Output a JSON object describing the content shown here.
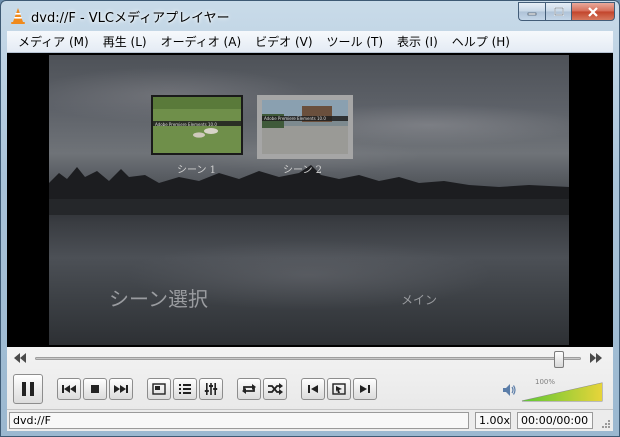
{
  "window": {
    "title": "dvd://F - VLCメディアプレイヤー"
  },
  "menu": {
    "items": [
      {
        "id": "media",
        "label": "メディア (M)"
      },
      {
        "id": "playback",
        "label": "再生 (L)"
      },
      {
        "id": "audio",
        "label": "オーディオ (A)"
      },
      {
        "id": "video",
        "label": "ビデオ (V)"
      },
      {
        "id": "tools",
        "label": "ツール (T)"
      },
      {
        "id": "view",
        "label": "表示 (I)"
      },
      {
        "id": "help",
        "label": "ヘルプ (H)"
      }
    ]
  },
  "dvd_menu": {
    "title": "シーン選択",
    "main_link": "メイン",
    "thumbnails": [
      {
        "caption": "シーン 1",
        "mini_text": "Adobe Premiere Elements 10.0",
        "selected": false
      },
      {
        "caption": "シーン 2",
        "mini_text": "Adobe Premiere Elements 10.0",
        "selected": true
      }
    ]
  },
  "player": {
    "seek_position": 0.97,
    "volume_label": "100%",
    "volume_level": 1.0,
    "status": {
      "media": "dvd://F",
      "speed": "1.00x",
      "time": "00:00/00:00"
    }
  },
  "colors": {
    "volume_low": "#5cc733",
    "volume_high": "#e7d43a"
  }
}
